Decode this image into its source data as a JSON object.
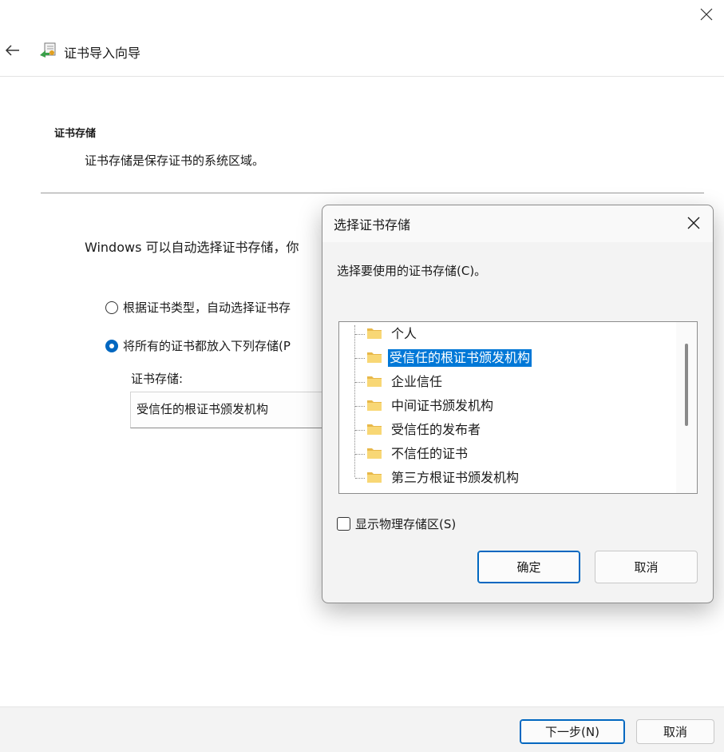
{
  "wizard": {
    "title": "证书导入向导",
    "section_title": "证书存储",
    "section_desc": "证书存储是保存证书的系统区域。",
    "intro": "Windows 可以自动选择证书存储，你",
    "radio_auto": "根据证书类型，自动选择证书存",
    "radio_manual": "将所有的证书都放入下列存储(P",
    "store_label": "证书存储:",
    "store_value": "受信任的根证书颁发机构",
    "next_button": "下一步(N)",
    "cancel_button": "取消"
  },
  "dialog": {
    "title": "选择证书存储",
    "prompt": "选择要使用的证书存储(C)。",
    "stores": [
      "个人",
      "受信任的根证书颁发机构",
      "企业信任",
      "中间证书颁发机构",
      "受信任的发布者",
      "不信任的证书",
      "第三方根证书颁发机构"
    ],
    "selected_index": 1,
    "show_physical": "显示物理存储区(S)",
    "show_physical_checked": false,
    "ok_button": "确定",
    "cancel_button": "取消"
  },
  "colors": {
    "accent": "#0078d7",
    "radio_accent": "#0067c0"
  }
}
